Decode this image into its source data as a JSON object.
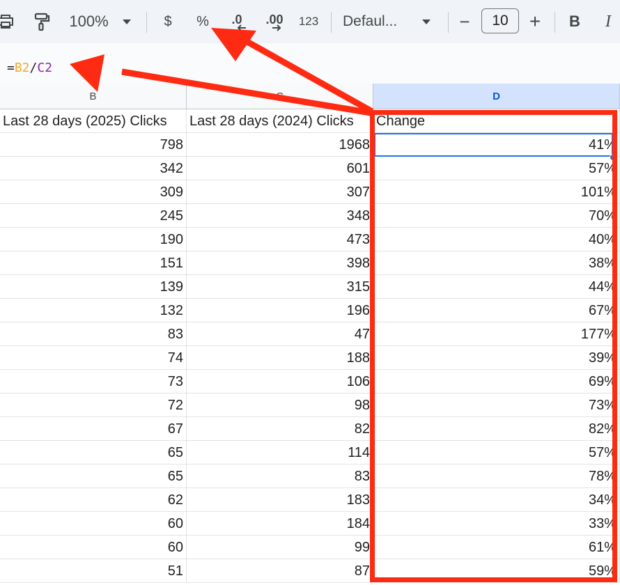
{
  "toolbar": {
    "zoom": "100%",
    "currency_symbol": "$",
    "percent_symbol": "%",
    "decrease_decimal": ".0",
    "increase_decimal": ".00",
    "number_format": "123",
    "font_name": "Defaul...",
    "font_size": "10",
    "minus": "−",
    "plus": "+",
    "bold": "B",
    "italic": "I"
  },
  "formula_bar": {
    "equals": "=",
    "ref1": "B2",
    "slash": "/",
    "ref2": "C2"
  },
  "columns": {
    "b": "B",
    "c": "C",
    "d": "D"
  },
  "sheet": {
    "headers": [
      "Last 28 days (2025) Clicks",
      "Last 28 days (2024) Clicks",
      "Change"
    ],
    "rows": [
      [
        "798",
        "1968",
        "41%"
      ],
      [
        "342",
        "601",
        "57%"
      ],
      [
        "309",
        "307",
        "101%"
      ],
      [
        "245",
        "348",
        "70%"
      ],
      [
        "190",
        "473",
        "40%"
      ],
      [
        "151",
        "398",
        "38%"
      ],
      [
        "139",
        "315",
        "44%"
      ],
      [
        "132",
        "196",
        "67%"
      ],
      [
        "83",
        "47",
        "177%"
      ],
      [
        "74",
        "188",
        "39%"
      ],
      [
        "73",
        "106",
        "69%"
      ],
      [
        "72",
        "98",
        "73%"
      ],
      [
        "67",
        "82",
        "82%"
      ],
      [
        "65",
        "114",
        "57%"
      ],
      [
        "65",
        "83",
        "78%"
      ],
      [
        "62",
        "183",
        "34%"
      ],
      [
        "60",
        "184",
        "33%"
      ],
      [
        "60",
        "99",
        "61%"
      ],
      [
        "51",
        "87",
        "59%"
      ]
    ]
  },
  "colors": {
    "annotation": "#ff2a12",
    "selection": "#1a73e8",
    "selected_header": "#d3e3fd"
  },
  "icons": [
    "print-icon",
    "paint-format-icon",
    "dropdown-caret-icon"
  ]
}
